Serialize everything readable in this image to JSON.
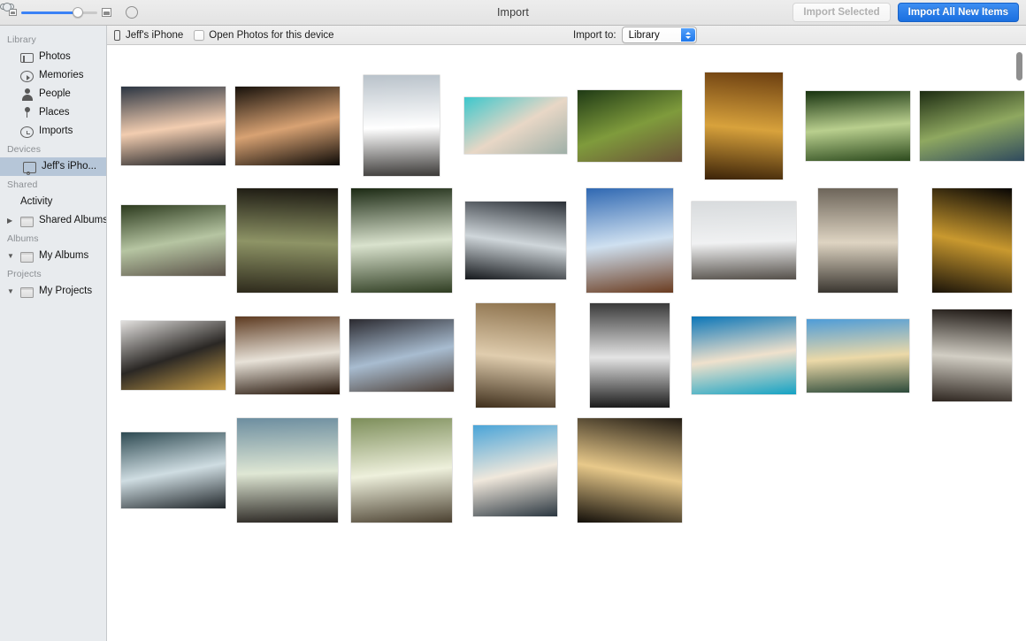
{
  "window": {
    "title": "Import"
  },
  "toolbar": {
    "zoom_slider": {
      "small_icon": "small-thumbnail-icon",
      "large_icon": "large-thumbnail-icon",
      "value_percent": 74
    },
    "circle_button_icon": "circle-outline-icon",
    "import_selected_label": "Import Selected",
    "import_selected_enabled": false,
    "import_all_label": "Import All New Items",
    "accent_color": "#1a6fe0"
  },
  "sidebar": {
    "groups": [
      {
        "header": "Library",
        "items": [
          {
            "label": "Photos",
            "icon": "photos-icon",
            "disclosure": "",
            "selected": false
          },
          {
            "label": "Memories",
            "icon": "memories-icon",
            "disclosure": "",
            "selected": false
          },
          {
            "label": "People",
            "icon": "people-icon",
            "disclosure": "",
            "selected": false
          },
          {
            "label": "Places",
            "icon": "places-icon",
            "disclosure": "",
            "selected": false
          },
          {
            "label": "Imports",
            "icon": "imports-icon",
            "disclosure": "",
            "selected": false
          }
        ]
      },
      {
        "header": "Devices",
        "items": [
          {
            "label": "Jeff's iPho...",
            "icon": "iphone-icon",
            "disclosure": "",
            "selected": true
          }
        ]
      },
      {
        "header": "Shared",
        "items": [
          {
            "label": "Activity",
            "icon": "cloud-icon",
            "disclosure": "",
            "selected": false
          },
          {
            "label": "Shared Albums",
            "icon": "folder-icon",
            "disclosure": "▶",
            "selected": false
          }
        ]
      },
      {
        "header": "Albums",
        "items": [
          {
            "label": "My Albums",
            "icon": "folder-icon",
            "disclosure": "▼",
            "selected": false
          }
        ]
      },
      {
        "header": "Projects",
        "items": [
          {
            "label": "My Projects",
            "icon": "folder-icon",
            "disclosure": "▼",
            "selected": false
          }
        ]
      }
    ],
    "selection_color": "#b6c6d8",
    "background_color": "#e8ebee"
  },
  "device_bar": {
    "device_name": "Jeff's iPhone",
    "device_icon": "iphone-icon",
    "open_photos_label": "Open Photos for this device",
    "open_photos_checked": false,
    "import_to_label": "Import to:",
    "import_to_value": "Library",
    "import_to_options": [
      "Library"
    ]
  },
  "grid": {
    "rows": [
      [
        {
          "name": "palm-trees-sunset-road",
          "w": 118,
          "h": 89,
          "c1": "#2b3542",
          "c2": "#f2cdb0",
          "c3": "#1a1d22",
          "angle": 172
        },
        {
          "name": "sunset-through-doorway",
          "w": 118,
          "h": 89,
          "c1": "#17110b",
          "c2": "#d8a273",
          "c3": "#0c0906",
          "angle": 168
        },
        {
          "name": "snow-volcano-hiker",
          "w": 86,
          "h": 114,
          "c1": "#b9c2ca",
          "c2": "#ffffff",
          "c3": "#3c3a38",
          "angle": 178
        },
        {
          "name": "underwater-turquoise",
          "w": 116,
          "h": 64,
          "c1": "#3dc7cc",
          "c2": "#e8d7c6",
          "c3": "#9fb0a8",
          "angle": 150
        },
        {
          "name": "chameleon-on-branch",
          "w": 118,
          "h": 81,
          "c1": "#1f3a15",
          "c2": "#7f9b3c",
          "c3": "#6b5238",
          "angle": 160
        },
        {
          "name": "lava-tube-tunnel",
          "w": 88,
          "h": 121,
          "c1": "#6b3e10",
          "c2": "#d8a23c",
          "c3": "#3b2208",
          "angle": 185
        },
        {
          "name": "jungle-stairs-path",
          "w": 118,
          "h": 79,
          "c1": "#17320f",
          "c2": "#b9cf8e",
          "c3": "#2c4a1d",
          "angle": 175
        },
        {
          "name": "horses-in-truck-bed",
          "w": 118,
          "h": 79,
          "c1": "#1d2c12",
          "c2": "#8fa860",
          "c3": "#2f4a5e",
          "angle": 165
        }
      ],
      [
        {
          "name": "horse-on-jungle-road",
          "w": 118,
          "h": 80,
          "c1": "#2c3a1e",
          "c2": "#b6c5a2",
          "c3": "#5a5148",
          "angle": 170
        },
        {
          "name": "banyan-tree-roots",
          "w": 114,
          "h": 118,
          "c1": "#1a1710",
          "c2": "#8e9466",
          "c3": "#2e2a1c",
          "angle": 182
        },
        {
          "name": "waterfall-jungle-trail",
          "w": 114,
          "h": 118,
          "c1": "#1c2a14",
          "c2": "#d9e2cd",
          "c3": "#2f3d22",
          "angle": 176
        },
        {
          "name": "city-skyline-window",
          "w": 114,
          "h": 88,
          "c1": "#2a2f36",
          "c2": "#cfd6da",
          "c3": "#15181c",
          "angle": 188
        },
        {
          "name": "autumn-lake-sky",
          "w": 98,
          "h": 118,
          "c1": "#2f68b2",
          "c2": "#cfe0f0",
          "c3": "#6b3c20",
          "angle": 172
        },
        {
          "name": "pier-statue-bay",
          "w": 118,
          "h": 88,
          "c1": "#d8dbdd",
          "c2": "#f0f1f2",
          "c3": "#55504a",
          "angle": 178
        },
        {
          "name": "stone-building-courtyard",
          "w": 90,
          "h": 118,
          "c1": "#6d655a",
          "c2": "#ded4c2",
          "c3": "#3a3630",
          "angle": 180
        },
        {
          "name": "gold-sculpture-dark",
          "w": 90,
          "h": 118,
          "c1": "#080604",
          "c2": "#c9992f",
          "c3": "#1a1309",
          "angle": 192
        }
      ],
      [
        {
          "name": "breakfast-tray-bed",
          "w": 118,
          "h": 78,
          "c1": "#e2e0de",
          "c2": "#2a2724",
          "c3": "#caa048",
          "angle": 162
        },
        {
          "name": "coffee-cup-wood-table",
          "w": 118,
          "h": 88,
          "c1": "#5d3a20",
          "c2": "#e8e2d8",
          "c3": "#241409",
          "angle": 174
        },
        {
          "name": "woman-balcony-city-view",
          "w": 118,
          "h": 82,
          "c1": "#2b2a30",
          "c2": "#a8bcd0",
          "c3": "#4a3c33",
          "angle": 168
        },
        {
          "name": "sagrada-familia-facade",
          "w": 90,
          "h": 118,
          "c1": "#8a6f4a",
          "c2": "#e0cdae",
          "c3": "#3f2f1c",
          "angle": 186
        },
        {
          "name": "bw-street-trees-hdr",
          "w": 90,
          "h": 118,
          "c1": "#3a3a3a",
          "c2": "#e4e4e4",
          "c3": "#1c1c1c",
          "angle": 180
        },
        {
          "name": "beach-turquoise-water",
          "w": 118,
          "h": 88,
          "c1": "#0b76b8",
          "c2": "#efe1cc",
          "c3": "#14a2c4",
          "angle": 172
        },
        {
          "name": "bay-beach-clouds",
          "w": 116,
          "h": 83,
          "c1": "#4e9cd8",
          "c2": "#ecd9a8",
          "c3": "#2c4a3a",
          "angle": 176
        },
        {
          "name": "train-station-platform",
          "w": 90,
          "h": 104,
          "c1": "#1a1410",
          "c2": "#d2cec4",
          "c3": "#2e2620",
          "angle": 184
        }
      ],
      [
        {
          "name": "rocky-coast-island",
          "w": 118,
          "h": 86,
          "c1": "#2e4a52",
          "c2": "#cfdde2",
          "c3": "#20262a",
          "angle": 170
        },
        {
          "name": "man-on-rocks-cliff",
          "w": 114,
          "h": 118,
          "c1": "#6d8ea0",
          "c2": "#dfe7d4",
          "c3": "#2a2622",
          "angle": 178
        },
        {
          "name": "park-bench-trees",
          "w": 114,
          "h": 118,
          "c1": "#7d8e5a",
          "c2": "#eef0dc",
          "c3": "#4a4030",
          "angle": 174
        },
        {
          "name": "group-photo-promenade",
          "w": 95,
          "h": 103,
          "c1": "#4aa4d8",
          "c2": "#f0e8dc",
          "c3": "#2a3640",
          "angle": 168
        },
        {
          "name": "ferris-wheel-sunset",
          "w": 118,
          "h": 118,
          "c1": "#221c14",
          "c2": "#e8c98a",
          "c3": "#120e09",
          "angle": 190
        }
      ]
    ]
  },
  "scrollbar": {
    "orientation": "vertical",
    "thumb_color": "#8e8e8e"
  }
}
